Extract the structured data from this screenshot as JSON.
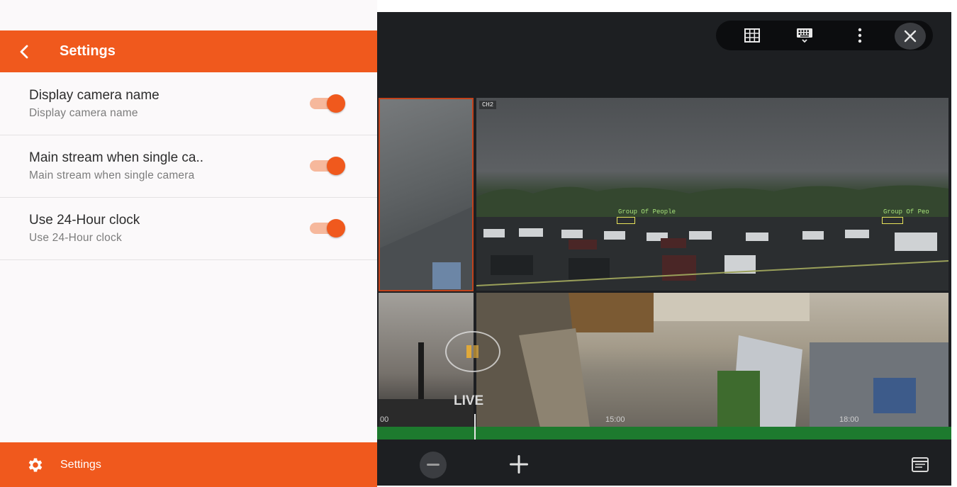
{
  "settings": {
    "title": "Settings",
    "items": [
      {
        "title": "Display camera name",
        "subtitle": "Display camera name",
        "enabled": true
      },
      {
        "title": "Main stream when single ca..",
        "subtitle": "Main stream when single camera",
        "enabled": true
      },
      {
        "title": "Use 24-Hour clock",
        "subtitle": "Use 24-Hour clock",
        "enabled": true
      }
    ],
    "footer_label": "Settings"
  },
  "video": {
    "camera_label": "CH2",
    "detections": [
      "Group Of People",
      "Group Of Peo"
    ],
    "live_label": "LIVE",
    "timeline_ticks": [
      "00",
      "15:00",
      "18:00"
    ]
  },
  "icons": {
    "back": "chevron-left-icon",
    "gear": "gear-icon",
    "grid": "grid-layout-icon",
    "keyboard": "keyboard-icon",
    "more": "more-vertical-icon",
    "close": "close-icon",
    "play": "play-icon",
    "minus": "zoom-out-icon",
    "plus": "zoom-in-icon",
    "calendar": "calendar-icon"
  },
  "colors": {
    "accent": "#f0591d",
    "toggle_track": "#f6b89c",
    "timeline": "#1d7a2e",
    "video_bg": "#1d1f22"
  }
}
